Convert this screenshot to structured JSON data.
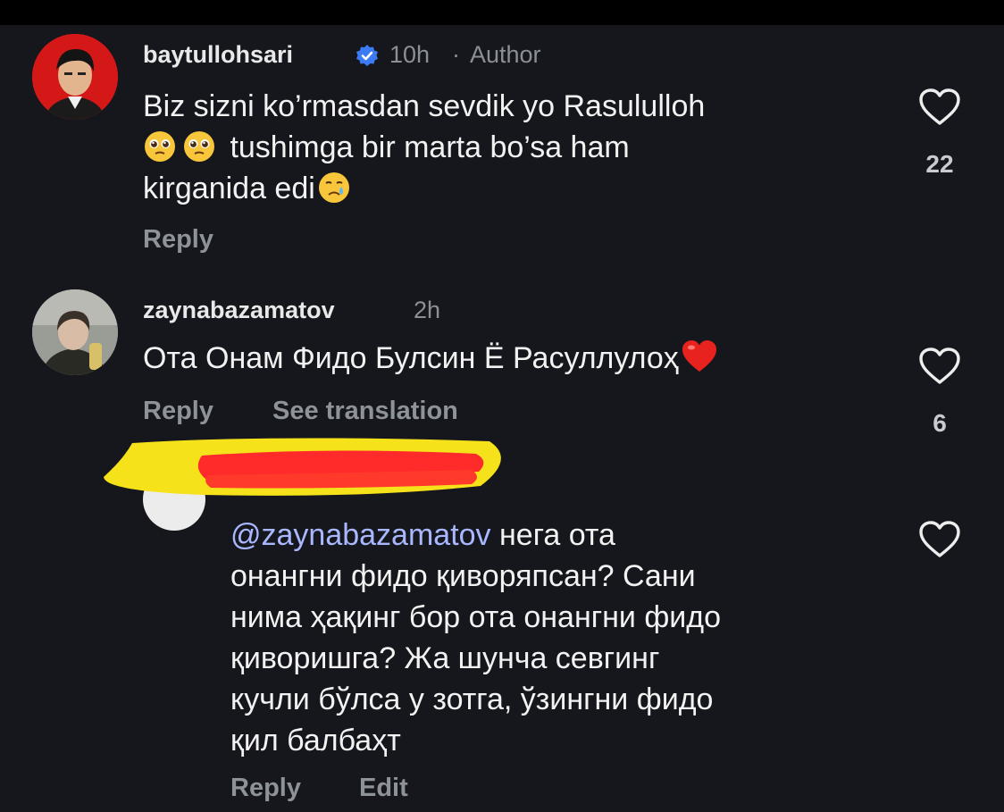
{
  "comments": [
    {
      "username": "baytullohsari",
      "time": "10h",
      "separator": "·",
      "author_label": "Author",
      "verified": true,
      "text_line1": "Biz sizni ko’rmasdan sevdik yo Rasululloh",
      "text_line2": "tushimga bir marta bo’sa ham",
      "text_line3": "kirganida edi",
      "emojis": [
        "pleading-face",
        "pleading-face",
        "crying-face"
      ],
      "reply_label": "Reply",
      "likes": "22"
    },
    {
      "username": "zaynabazamatov",
      "time": "2h",
      "text": "Ота Онам Фидо Булсин Ё Расуллулоҳ",
      "emojis": [
        "red-heart"
      ],
      "reply_label": "Reply",
      "translate_label": "See translation",
      "likes": "6"
    },
    {
      "username_redacted": true,
      "mention": "@zaynabazamatov",
      "text_line1": " нега ота",
      "text_line2": "онангни фидо қиворяпсан? Сани",
      "text_line3": "нима ҳақинг бор ота онангни фидо",
      "text_line4": "қиворишга? Жа шунча севгинг",
      "text_line5": "кучли бўлса у зотга, ўзингни фидо",
      "text_line6": "қил балбаҳт",
      "reply_label": "Reply",
      "edit_label": "Edit"
    }
  ],
  "colors": {
    "background": "#15171c",
    "text": "#f2f2f2",
    "secondary": "#8b8f98",
    "mention": "#a9b7ff",
    "verified": "#3b7bf5",
    "redaction_red": "#ff2a2a",
    "redaction_yellow": "#f5e21a"
  }
}
